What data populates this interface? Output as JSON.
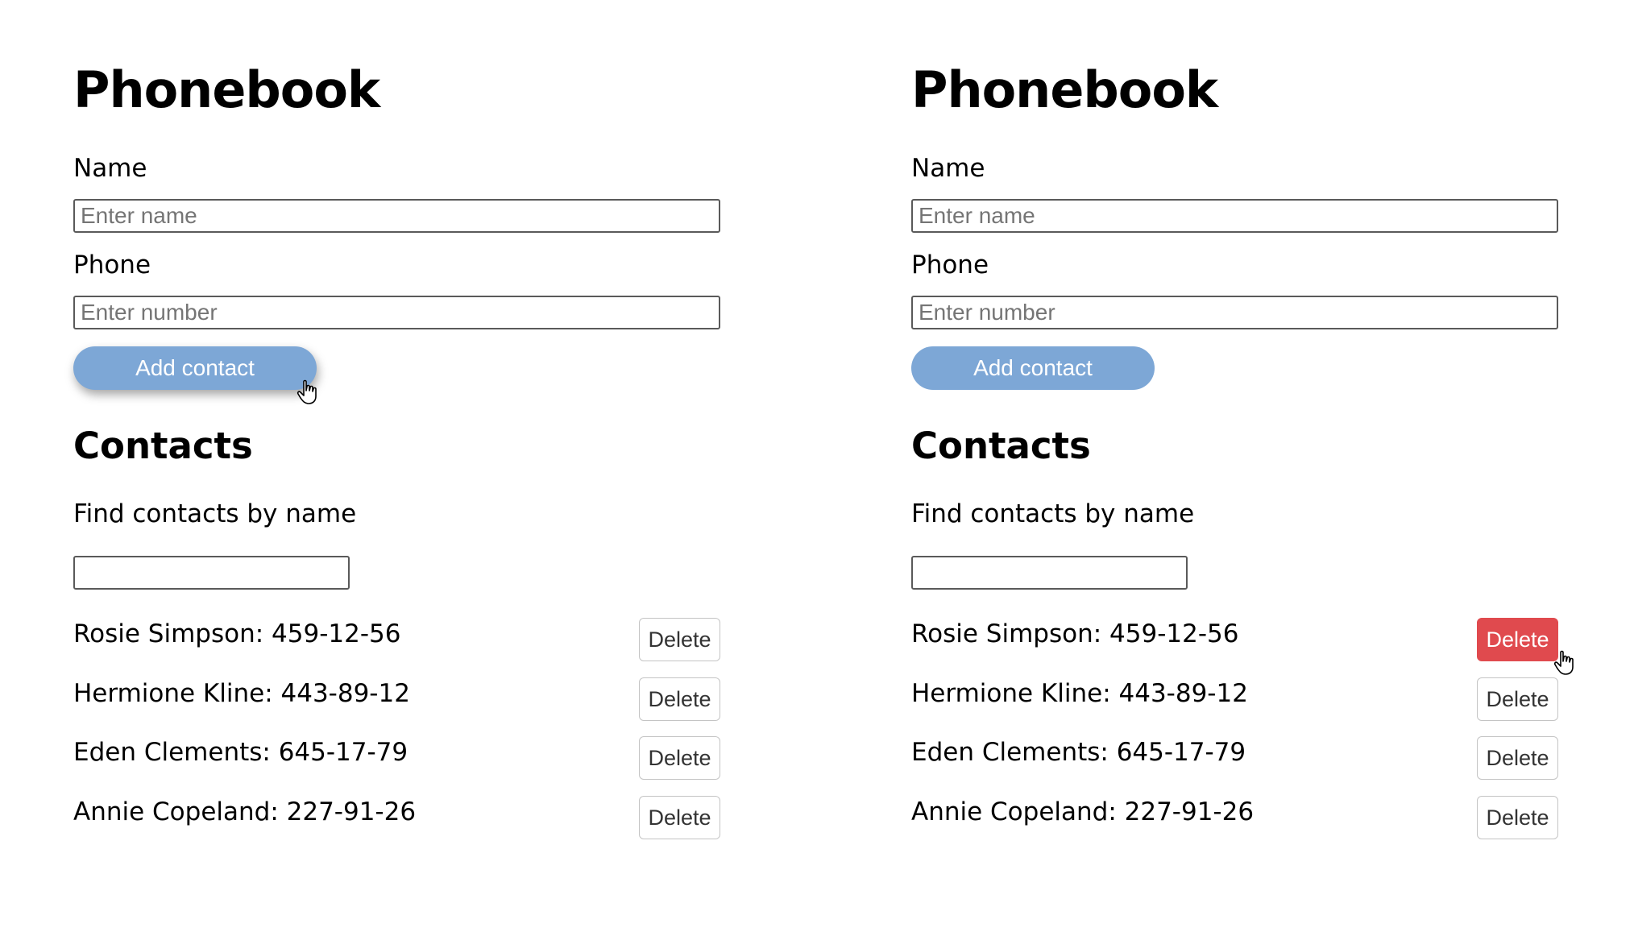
{
  "panels": [
    {
      "title": "Phonebook",
      "name_label": "Name",
      "name_placeholder": "Enter name",
      "phone_label": "Phone",
      "phone_placeholder": "Enter number",
      "add_button": "Add contact",
      "contacts_heading": "Contacts",
      "filter_label": "Find contacts by name",
      "filter_value": "",
      "contacts": [
        {
          "text": "Rosie Simpson: 459-12-56",
          "delete": "Delete"
        },
        {
          "text": "Hermione Kline: 443-89-12",
          "delete": "Delete"
        },
        {
          "text": "Eden Clements: 645-17-79",
          "delete": "Delete"
        },
        {
          "text": "Annie Copeland: 227-91-26",
          "delete": "Delete"
        }
      ],
      "cursor_icon": "hand-pointer-icon"
    },
    {
      "title": "Phonebook",
      "name_label": "Name",
      "name_placeholder": "Enter name",
      "phone_label": "Phone",
      "phone_placeholder": "Enter number",
      "add_button": "Add contact",
      "contacts_heading": "Contacts",
      "filter_label": "Find contacts by name",
      "filter_value": "",
      "contacts": [
        {
          "text": "Rosie Simpson: 459-12-56",
          "delete": "Delete",
          "hovered": true
        },
        {
          "text": "Hermione Kline: 443-89-12",
          "delete": "Delete"
        },
        {
          "text": "Eden Clements: 645-17-79",
          "delete": "Delete"
        },
        {
          "text": "Annie Copeland: 227-91-26",
          "delete": "Delete"
        }
      ],
      "cursor_icon": "hand-pointer-icon"
    }
  ],
  "colors": {
    "add_button_bg": "#7da7d6",
    "delete_hover_bg": "#e04a4e",
    "input_border": "#5a5a5a"
  }
}
